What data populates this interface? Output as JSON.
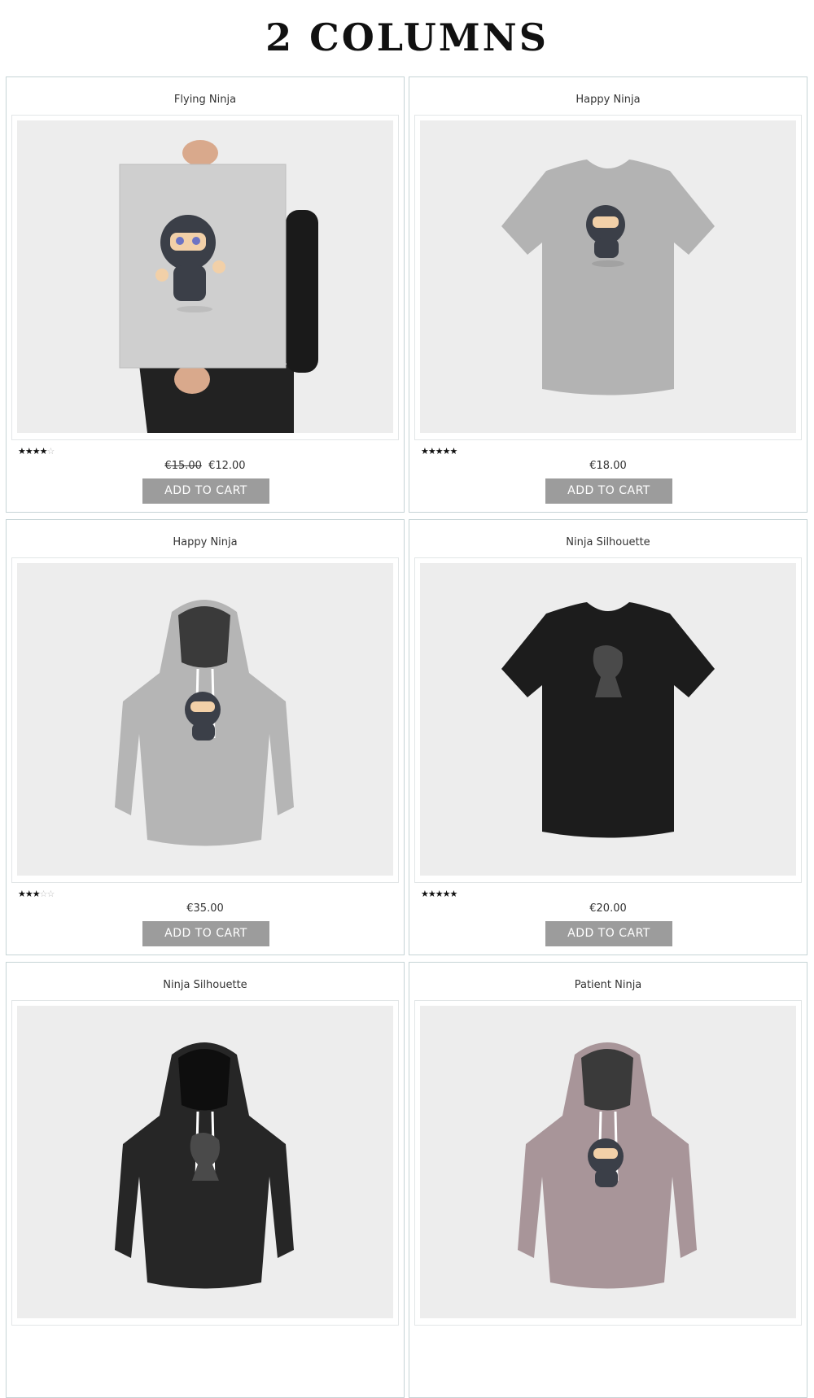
{
  "page": {
    "title": "2 COLUMNS"
  },
  "products": [
    {
      "name": "Flying Ninja",
      "rating": 4,
      "price_old": "€15.00",
      "price": "€12.00",
      "button": "ADD TO CART",
      "image": "poster"
    },
    {
      "name": "Happy Ninja",
      "rating": 5,
      "price_old": "",
      "price": "€18.00",
      "button": "ADD TO CART",
      "image": "tshirt-grey"
    },
    {
      "name": "Happy Ninja",
      "rating": 3,
      "price_old": "",
      "price": "€35.00",
      "button": "ADD TO CART",
      "image": "hoodie-grey"
    },
    {
      "name": "Ninja Silhouette",
      "rating": 5,
      "price_old": "",
      "price": "€20.00",
      "button": "ADD TO CART",
      "image": "tshirt-black"
    },
    {
      "name": "Ninja Silhouette",
      "rating": null,
      "price_old": "",
      "price": "",
      "button": "",
      "image": "hoodie-black"
    },
    {
      "name": "Patient Ninja",
      "rating": null,
      "price_old": "",
      "price": "",
      "button": "",
      "image": "hoodie-pink"
    }
  ],
  "icons": {
    "star_filled": "star-icon",
    "star_empty": "star-outline-icon"
  },
  "colors": {
    "border": "#c6d4d6",
    "button_bg": "#9c9c9c",
    "image_bg": "#ededed"
  }
}
